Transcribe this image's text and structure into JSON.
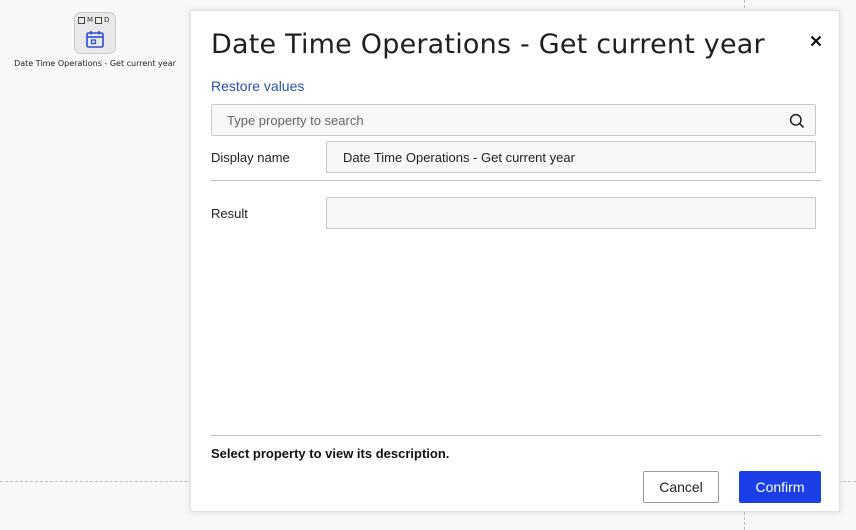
{
  "canvas": {
    "node": {
      "flag_m": "M",
      "flag_d": "D",
      "icon": "calendar-icon",
      "label": "Date Time Operations - Get current year"
    }
  },
  "dialog": {
    "title": "Date Time Operations - Get current year",
    "close_icon": "close-icon",
    "restore_label": "Restore values",
    "search": {
      "placeholder": "Type property to search",
      "value": "",
      "icon": "search-icon"
    },
    "properties": [
      {
        "label": "Display name",
        "value": "Date Time Operations - Get current year"
      },
      {
        "label": "Result",
        "value": ""
      }
    ],
    "description": "Select property to view its description.",
    "cancel_label": "Cancel",
    "confirm_label": "Confirm"
  },
  "colors": {
    "accent": "#1a3ee8",
    "link": "#2f4fb5",
    "icon_blue": "#2b4bd6"
  }
}
